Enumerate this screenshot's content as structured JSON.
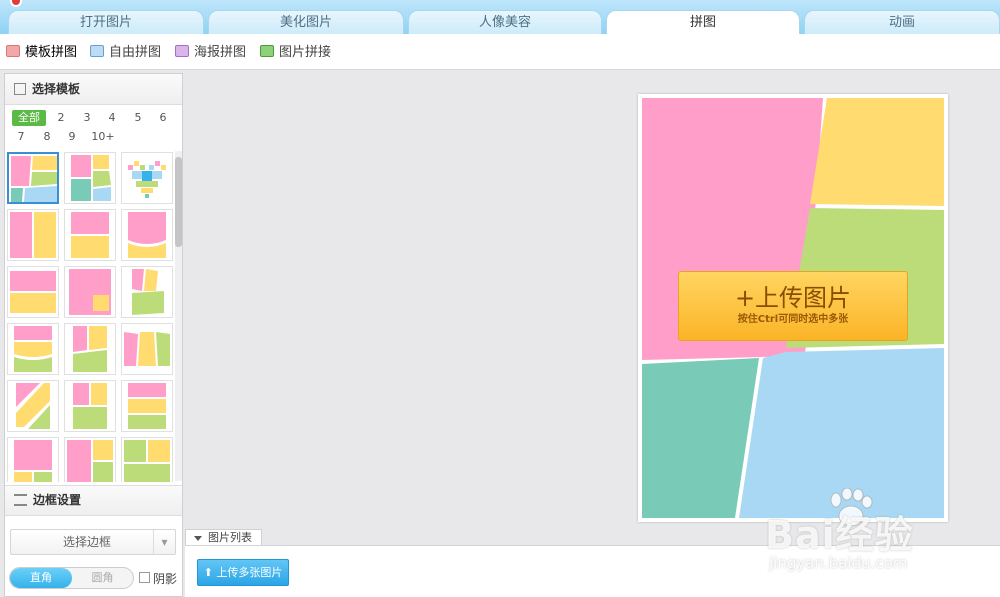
{
  "tabs": [
    {
      "label": "打开图片"
    },
    {
      "label": "美化图片"
    },
    {
      "label": "人像美容"
    },
    {
      "label": "拼图",
      "active": true
    },
    {
      "label": "动画"
    }
  ],
  "subtoolbar": [
    {
      "label": "模板拼图",
      "icon": "template-collage-icon",
      "active": true
    },
    {
      "label": "自由拼图",
      "icon": "free-collage-icon"
    },
    {
      "label": "海报拼图",
      "icon": "poster-collage-icon"
    },
    {
      "label": "图片拼接",
      "icon": "image-stitch-icon"
    }
  ],
  "left_panel": {
    "title": "选择模板",
    "filters": [
      "全部",
      "2",
      "3",
      "4",
      "5",
      "6",
      "7",
      "8",
      "9",
      "10+"
    ],
    "active_filter": "全部",
    "border_section_title": "边框设置",
    "select_border_label": "选择边框",
    "corner_square": "直角",
    "corner_round": "圆角",
    "shadow_label": "阴影"
  },
  "canvas": {
    "upload_main": "+上传图片",
    "upload_sub": "按住Ctrl可同时选中多张"
  },
  "bottom": {
    "tab_label": "图片列表",
    "upload_multi": "上传多张图片"
  },
  "watermark": {
    "brand": "Bai经验",
    "url": "jingyan.baidu.com"
  },
  "colors": {
    "pink": "#ff9ec8",
    "yellow": "#ffdb70",
    "green": "#bbdc78",
    "teal": "#79cbb8",
    "blue": "#a9d8f5",
    "accent_green": "#5aba45",
    "accent_blue": "#35b2ea"
  }
}
